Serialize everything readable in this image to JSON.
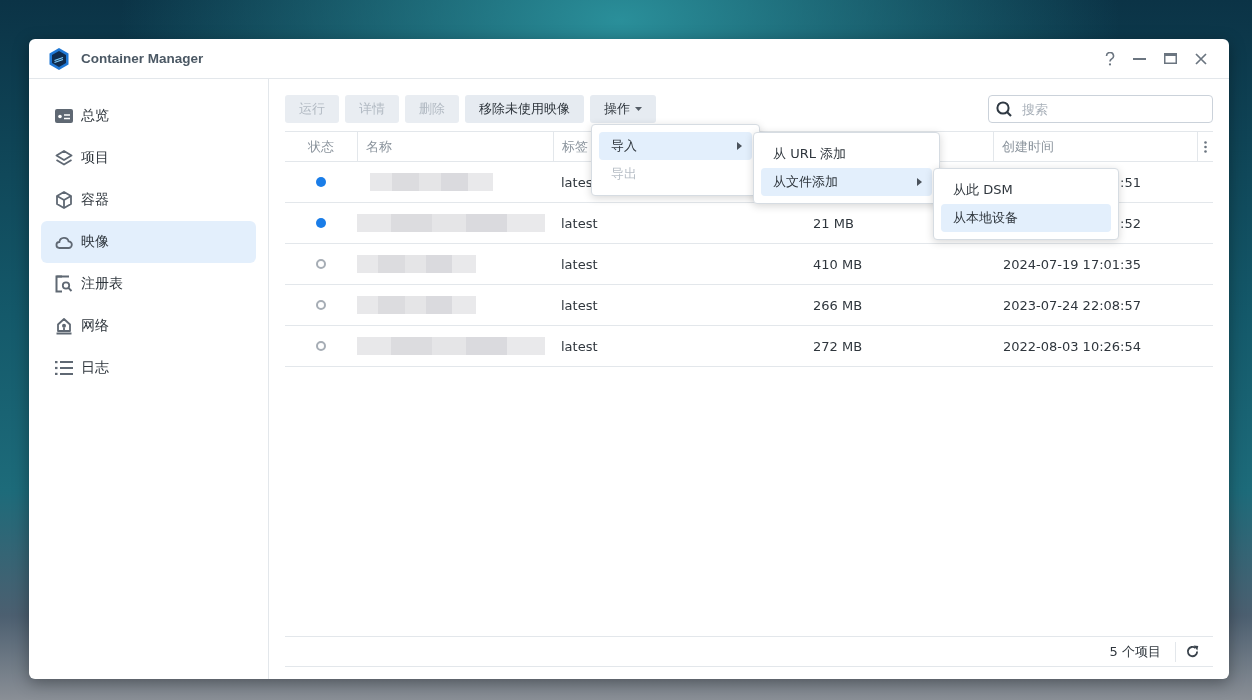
{
  "window": {
    "title": "Container Manager"
  },
  "sidebar": {
    "items": [
      {
        "label": "总览",
        "selected": false
      },
      {
        "label": "项目",
        "selected": false
      },
      {
        "label": "容器",
        "selected": false
      },
      {
        "label": "映像",
        "selected": true
      },
      {
        "label": "注册表",
        "selected": false
      },
      {
        "label": "网络",
        "selected": false
      },
      {
        "label": "日志",
        "selected": false
      }
    ]
  },
  "toolbar": {
    "buttons": [
      {
        "label": "运行",
        "kind": "plain",
        "disabled": true
      },
      {
        "label": "详情",
        "kind": "plain",
        "disabled": true
      },
      {
        "label": "删除",
        "kind": "plain",
        "disabled": true
      },
      {
        "label": "移除未使用映像",
        "kind": "plain",
        "disabled": false
      },
      {
        "label": "操作",
        "kind": "dropdown",
        "disabled": false,
        "menu": [
          {
            "label": "导入",
            "selected": true,
            "disabled": false,
            "children": [
              {
                "label": "从 URL 添加",
                "selected": false,
                "disabled": false
              },
              {
                "label": "从文件添加",
                "selected": true,
                "disabled": false,
                "children": [
                  {
                    "label": "从此 DSM",
                    "selected": false,
                    "disabled": false
                  },
                  {
                    "label": "从本地设备",
                    "selected": true,
                    "disabled": false
                  }
                ]
              }
            ]
          },
          {
            "label": "导出",
            "selected": false,
            "disabled": true
          }
        ]
      }
    ]
  },
  "search": {
    "placeholder": "搜索"
  },
  "table": {
    "columns": [
      "状态",
      "名称",
      "标签",
      null,
      "创建时间"
    ],
    "rows": [
      {
        "running": true,
        "tag": "lates",
        "time": ":51"
      },
      {
        "running": true,
        "tag": "latest",
        "size": "21 MB",
        "time": ":52"
      },
      {
        "running": false,
        "tag": "latest",
        "size": "410 MB",
        "time": "2024-07-19 17:01:35"
      },
      {
        "running": false,
        "tag": "latest",
        "size": "266 MB",
        "time": "2023-07-24 22:08:57"
      },
      {
        "running": false,
        "tag": "latest",
        "size": "272 MB",
        "time": "2022-08-03 10:26:54"
      }
    ]
  },
  "status_bar": {
    "count": "5 个项目"
  }
}
